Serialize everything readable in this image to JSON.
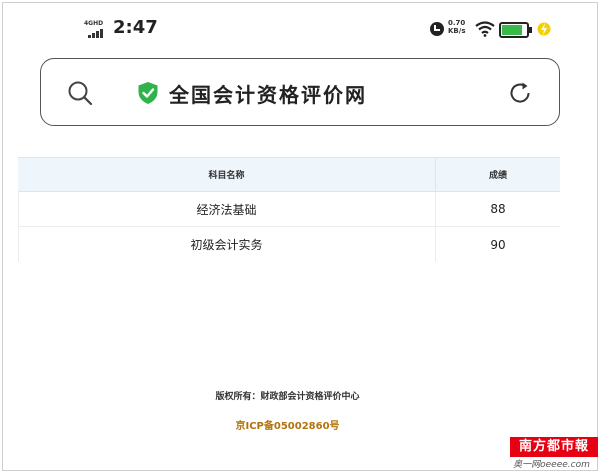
{
  "status_bar": {
    "network": "4GHD",
    "time": "2:47",
    "speed_value": "0.70",
    "speed_unit": "KB/s",
    "battery_level": 0.85
  },
  "address_bar": {
    "site_title": "全国会计资格评价网"
  },
  "results_table": {
    "headers": [
      "科目名称",
      "成绩"
    ],
    "rows": [
      {
        "subject": "经济法基础",
        "score": "88"
      },
      {
        "subject": "初级会计实务",
        "score": "90"
      }
    ]
  },
  "footer": {
    "copyright": "版权所有：财政部会计资格评价中心",
    "icp": "京ICP备05002860号"
  },
  "watermark": {
    "brand": "南方都市報",
    "sub": "奥一网oeeee.com"
  },
  "colors": {
    "shield": "#2fb34a",
    "battery": "#3bb84a",
    "icp": "#b2730e",
    "header_bg": "#eef5fb",
    "watermark": "#e60012"
  },
  "icons": [
    "search-icon",
    "shield-icon",
    "refresh-icon",
    "wifi-icon",
    "alarm-icon",
    "charging-icon"
  ]
}
